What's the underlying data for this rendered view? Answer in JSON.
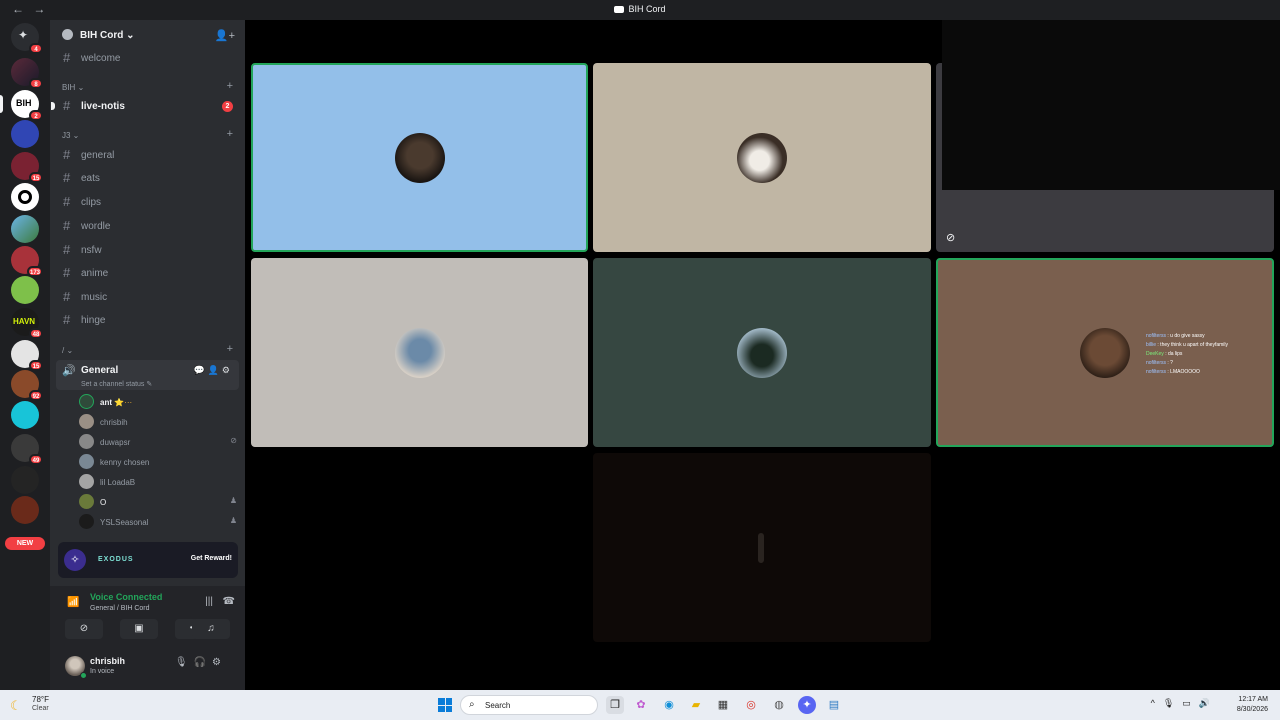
{
  "window": {
    "title": "BIH Cord",
    "back_icon": "←",
    "forward_icon": "→"
  },
  "servers": {
    "badges": [
      "4",
      "8",
      "2",
      "15",
      "173",
      "48",
      "15",
      "92",
      "49"
    ],
    "new_label": "NEW"
  },
  "guild": {
    "name": "BIH Cord"
  },
  "channels": {
    "welcome": "welcome",
    "cat_bih": "BIH",
    "live_notis": "live-notis",
    "live_notis_mentions": "2",
    "cat_j3": "J3",
    "text": [
      "general",
      "eats",
      "clips",
      "wordle",
      "nsfw",
      "anime",
      "music",
      "hinge"
    ],
    "cat_slash": "/"
  },
  "voice_channel": {
    "name": "General",
    "status_placeholder": "Set a channel status",
    "members": [
      {
        "name": "ant",
        "extra": "⭐···"
      },
      {
        "name": "chrisbih"
      },
      {
        "name": "duwapsr"
      },
      {
        "name": "kenny chosen"
      },
      {
        "name": "lil LoadaB"
      },
      {
        "name": "O"
      },
      {
        "name": "YSLSeasonal"
      }
    ]
  },
  "promo": {
    "brand": "EXODUS",
    "cta": "Get Reward!"
  },
  "voice_panel": {
    "status": "Voice Connected",
    "location": "General / BIH Cord"
  },
  "user": {
    "name": "chrisbih",
    "status": "In voice"
  },
  "stream_chat": [
    {
      "user": "nofilterss",
      "text": ": u do give sassy"
    },
    {
      "user": "billie",
      "text": ": they think u apart of theyfamily"
    },
    {
      "user": "DeeKey",
      "text": ": da lips"
    },
    {
      "user": "nofilterss",
      "text": ": ?"
    },
    {
      "user": "nofilterss",
      "text": ": LMAOOOOO"
    }
  ],
  "taskbar": {
    "temp": "78°F",
    "condition": "Clear",
    "search": "Search",
    "time": "12:17 AM",
    "date": "8/30/2026"
  },
  "colors": {
    "tile_blue": "#93bfe9",
    "tile_tan": "#c0b6a4",
    "tile_grey": "#c1bdb8",
    "tile_teal": "#364741",
    "tile_brown": "#7a5f4e",
    "speaking_green": "#23a55a",
    "mention_red": "#f23f43"
  }
}
